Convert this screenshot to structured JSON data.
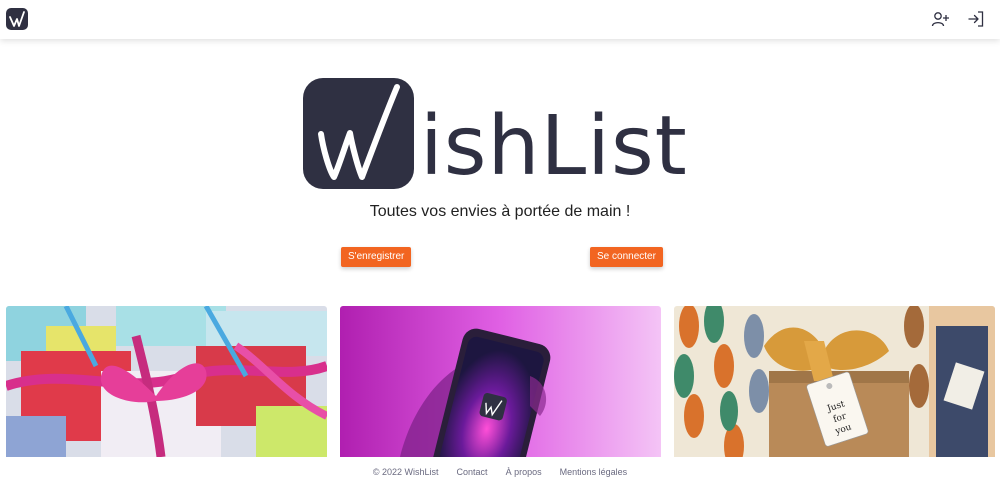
{
  "brand": {
    "name": "WishList",
    "logo_letter": "W",
    "logo_text": "ishList",
    "color": "#2f3042"
  },
  "nav": {
    "register_icon": "user-plus-icon",
    "login_icon": "sign-in-icon"
  },
  "hero": {
    "tagline": "Toutes vos envies à portée de main !",
    "register_label": "S'enregistrer",
    "login_label": "Se connecter",
    "button_color": "#f26521"
  },
  "cards": [
    {
      "image": "gift-boxes-with-ribbons"
    },
    {
      "image": "phone-with-wishlist-app"
    },
    {
      "image": "gift-bag-with-tag"
    }
  ],
  "footer": {
    "copyright": "© 2022 WishList",
    "links": [
      "Contact",
      "À propos",
      "Mentions légales"
    ]
  }
}
